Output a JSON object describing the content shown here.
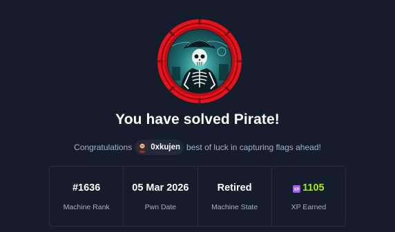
{
  "machine": {
    "avatar_icon": "skeleton-pirate-avatar",
    "ring_color": "#e8141b"
  },
  "headline": "You have solved Pirate!",
  "congrats": {
    "prefix": "Congratulations",
    "username": "0xkujen",
    "user_avatar_icon": "user-avatar-icon",
    "suffix": "best of luck in capturing flags ahead!"
  },
  "stats": [
    {
      "value": "#1636",
      "label": "Machine Rank"
    },
    {
      "value": "05 Mar 2026",
      "label": "Pwn Date"
    },
    {
      "value": "Retired",
      "label": "Machine State"
    },
    {
      "value": "1105",
      "label": "XP Earned",
      "icon": "xp-icon",
      "color": "#9fef00"
    }
  ]
}
